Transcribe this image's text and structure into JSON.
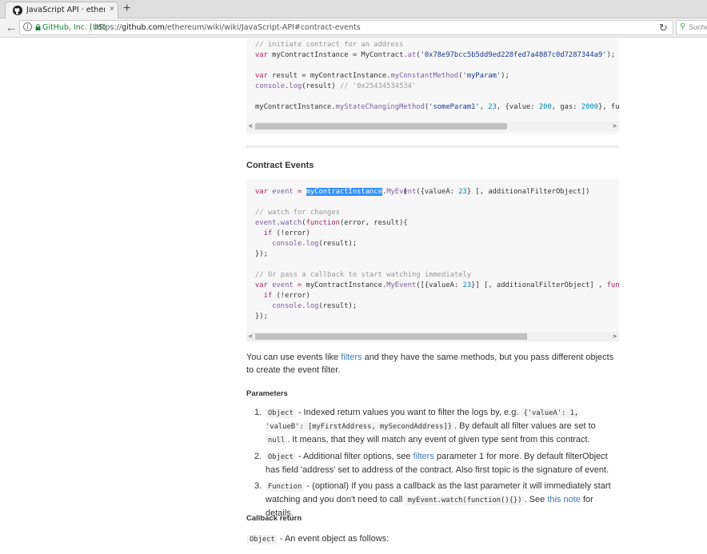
{
  "browser": {
    "tab_title": "JavaScript API · ethereum/...",
    "tab_close": "×",
    "new_tab": "+",
    "back": "←",
    "info": "i",
    "org": "GitHub, Inc. (US)",
    "url_prefix": "https://",
    "url_host": "github.com",
    "url_path": "/ethereum/wiki/wiki/JavaScript-API#contract-events",
    "reload": "↻",
    "search_placeholder": "Suche"
  },
  "code_top": {
    "lines": [
      [
        {
          "t": "// initiate contract for an address",
          "c": "cm"
        }
      ],
      [
        {
          "t": "var",
          "c": "kw"
        },
        {
          "t": " myContractInstance = MyContract."
        },
        {
          "t": "at",
          "c": "fn"
        },
        {
          "t": "("
        },
        {
          "t": "'0x78e97bcc5b5dd9ed228fed7a4887c0d7287344a9'",
          "c": "st"
        },
        {
          "t": ");"
        }
      ],
      [],
      [
        {
          "t": "var",
          "c": "kw"
        },
        {
          "t": " result = myContractInstance."
        },
        {
          "t": "myConstantMethod",
          "c": "fn"
        },
        {
          "t": "("
        },
        {
          "t": "'myParam'",
          "c": "st"
        },
        {
          "t": ");"
        }
      ],
      [
        {
          "t": "console",
          "c": "vr"
        },
        {
          "t": "."
        },
        {
          "t": "log",
          "c": "fn"
        },
        {
          "t": "(result) "
        },
        {
          "t": "// '0x25434534534'",
          "c": "cm"
        }
      ],
      [],
      [
        {
          "t": "myContractInstance."
        },
        {
          "t": "myStateChangingMethod",
          "c": "fn"
        },
        {
          "t": "("
        },
        {
          "t": "'someParam1'",
          "c": "st"
        },
        {
          "t": ", "
        },
        {
          "t": "23",
          "c": "nu"
        },
        {
          "t": ", {value: "
        },
        {
          "t": "200",
          "c": "nu"
        },
        {
          "t": ", gas: "
        },
        {
          "t": "2000",
          "c": "nu"
        },
        {
          "t": "}, fu"
        }
      ]
    ]
  },
  "section_title": "Contract Events",
  "code_events": {
    "lines": [
      [
        {
          "t": "var",
          "c": "kw"
        },
        {
          "t": " "
        },
        {
          "t": "event",
          "c": "vr"
        },
        {
          "t": " "
        },
        {
          "t": "=",
          "c": "kw"
        },
        {
          "t": " "
        },
        {
          "t": "myContractInstance",
          "c": "hl"
        },
        {
          "t": "."
        },
        {
          "t": "MyEvent",
          "c": "fn"
        },
        {
          "t": "({valueA: "
        },
        {
          "t": "23",
          "c": "nu"
        },
        {
          "t": "} [, additionalFilterObject])"
        }
      ],
      [],
      [
        {
          "t": "// watch for changes",
          "c": "cm"
        }
      ],
      [
        {
          "t": "event",
          "c": "vr"
        },
        {
          "t": "."
        },
        {
          "t": "watch",
          "c": "fn"
        },
        {
          "t": "("
        },
        {
          "t": "function",
          "c": "kw"
        },
        {
          "t": "(error, result){"
        }
      ],
      [
        {
          "t": "  "
        },
        {
          "t": "if",
          "c": "kw"
        },
        {
          "t": " (!error)"
        }
      ],
      [
        {
          "t": "    "
        },
        {
          "t": "console",
          "c": "vr"
        },
        {
          "t": "."
        },
        {
          "t": "log",
          "c": "fn"
        },
        {
          "t": "(result);"
        }
      ],
      [
        {
          "t": "});"
        }
      ],
      [],
      [
        {
          "t": "// Or pass a callback to start watching immediately",
          "c": "cm"
        }
      ],
      [
        {
          "t": "var",
          "c": "kw"
        },
        {
          "t": " "
        },
        {
          "t": "event",
          "c": "vr"
        },
        {
          "t": " "
        },
        {
          "t": "=",
          "c": "kw"
        },
        {
          "t": " myContractInstance."
        },
        {
          "t": "MyEvent",
          "c": "fn"
        },
        {
          "t": "([{valueA: "
        },
        {
          "t": "23",
          "c": "nu"
        },
        {
          "t": "}] [, additionalFilterObject] , "
        },
        {
          "t": "fun",
          "c": "kw"
        }
      ],
      [
        {
          "t": "  "
        },
        {
          "t": "if",
          "c": "kw"
        },
        {
          "t": " (!error)"
        }
      ],
      [
        {
          "t": "    "
        },
        {
          "t": "console",
          "c": "vr"
        },
        {
          "t": "."
        },
        {
          "t": "log",
          "c": "fn"
        },
        {
          "t": "(result);"
        }
      ],
      [
        {
          "t": "});"
        }
      ]
    ]
  },
  "scroll": {
    "left": "<",
    "right": ">"
  },
  "intro": {
    "before": "You can use events like ",
    "link": "filters",
    "after": " and they have the same methods, but you pass different objects to create the event filter."
  },
  "parameters_title": "Parameters",
  "parameters": [
    {
      "num": "1.",
      "parts": [
        {
          "code": "Object"
        },
        {
          "text": " - Indexed return values you want to filter the logs by, e.g. "
        },
        {
          "code": "{'valueA': 1, 'valueB': [myFirstAddress, mySecondAddress]}"
        },
        {
          "text": ". By default all filter values are set to "
        },
        {
          "code": "null"
        },
        {
          "text": ". It means, that they will match any event of given type sent from this contract."
        }
      ]
    },
    {
      "num": "2.",
      "parts": [
        {
          "code": "Object"
        },
        {
          "text": " - Additional filter options, see "
        },
        {
          "link": "filters"
        },
        {
          "text": " parameter 1 for more. By default filterObject has field 'address' set to address of the contract. Also first topic is the signature of event."
        }
      ]
    },
    {
      "num": "3.",
      "parts": [
        {
          "code": "Function"
        },
        {
          "text": " - (optional) If you pass a callback as the last parameter it will immediately start watching and you don't need to call "
        },
        {
          "code": "myEvent.watch(function(){})"
        },
        {
          "text": ". See "
        },
        {
          "link": "this note"
        },
        {
          "text": " for details."
        }
      ]
    }
  ],
  "callback_title": "Callback return",
  "callback": {
    "code": "Object",
    "text": " - An event object as follows:"
  }
}
